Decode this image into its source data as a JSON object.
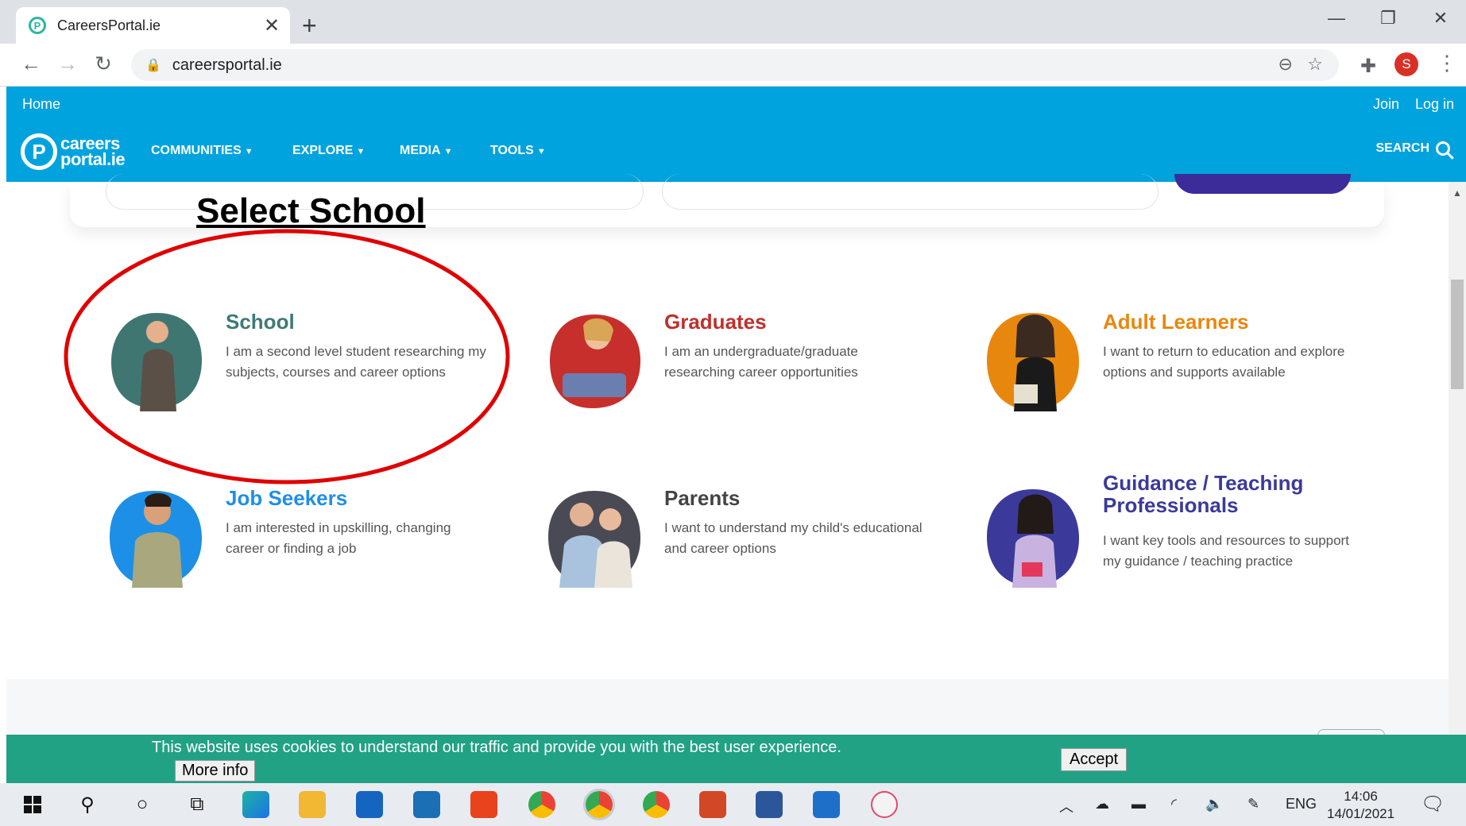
{
  "browser": {
    "tab_title": "CareersPortal.ie",
    "tab_close": "✕",
    "new_tab": "+",
    "url": "careersportal.ie",
    "profile_initial": "S",
    "win_min": "—",
    "win_max": "❐",
    "win_close": "✕"
  },
  "site": {
    "top_links": {
      "home": "Home",
      "join": "Join",
      "login": "Log in"
    },
    "logo": {
      "line1": "careers",
      "line2": "portal.ie"
    },
    "nav": [
      "COMMUNITIES",
      "EXPLORE",
      "MEDIA",
      "TOOLS"
    ],
    "search": "SEARCH",
    "accent": "#00a3de"
  },
  "annotation": {
    "title": "Select School",
    "color": "#e00000"
  },
  "audiences": [
    {
      "title": "School",
      "desc": "I am a second level student researching my subjects, courses and career options",
      "color": "#3e7a76",
      "blob": "#3f7672"
    },
    {
      "title": "Graduates",
      "desc": "I am an undergraduate/graduate researching career opportunities",
      "color": "#c0302d",
      "blob": "#c62f2b"
    },
    {
      "title": "Adult Learners",
      "desc": "I want to return to education and explore options and supports available",
      "color": "#e8870e",
      "blob": "#e8870e"
    },
    {
      "title": "Job Seekers",
      "desc": "I am interested in upskilling, changing career or finding a job",
      "color": "#1e8fe6",
      "blob": "#1e8fe6"
    },
    {
      "title": "Parents",
      "desc": "I want to understand my child's educational and career options",
      "color": "#444444",
      "blob": "#4a4a55"
    },
    {
      "title": "Guidance / Teaching Professionals",
      "desc": "I want key tools and resources to support my guidance / teaching practice",
      "color": "#3b3a9a",
      "blob": "#3b3a9a"
    }
  ],
  "cookie": {
    "text": "This website uses cookies to understand our traffic and provide you with the best user experience.",
    "more_info": "More info",
    "accept": "Accept"
  },
  "taskbar": {
    "lang": "ENG",
    "time": "14:06",
    "date": "14/01/2021"
  }
}
